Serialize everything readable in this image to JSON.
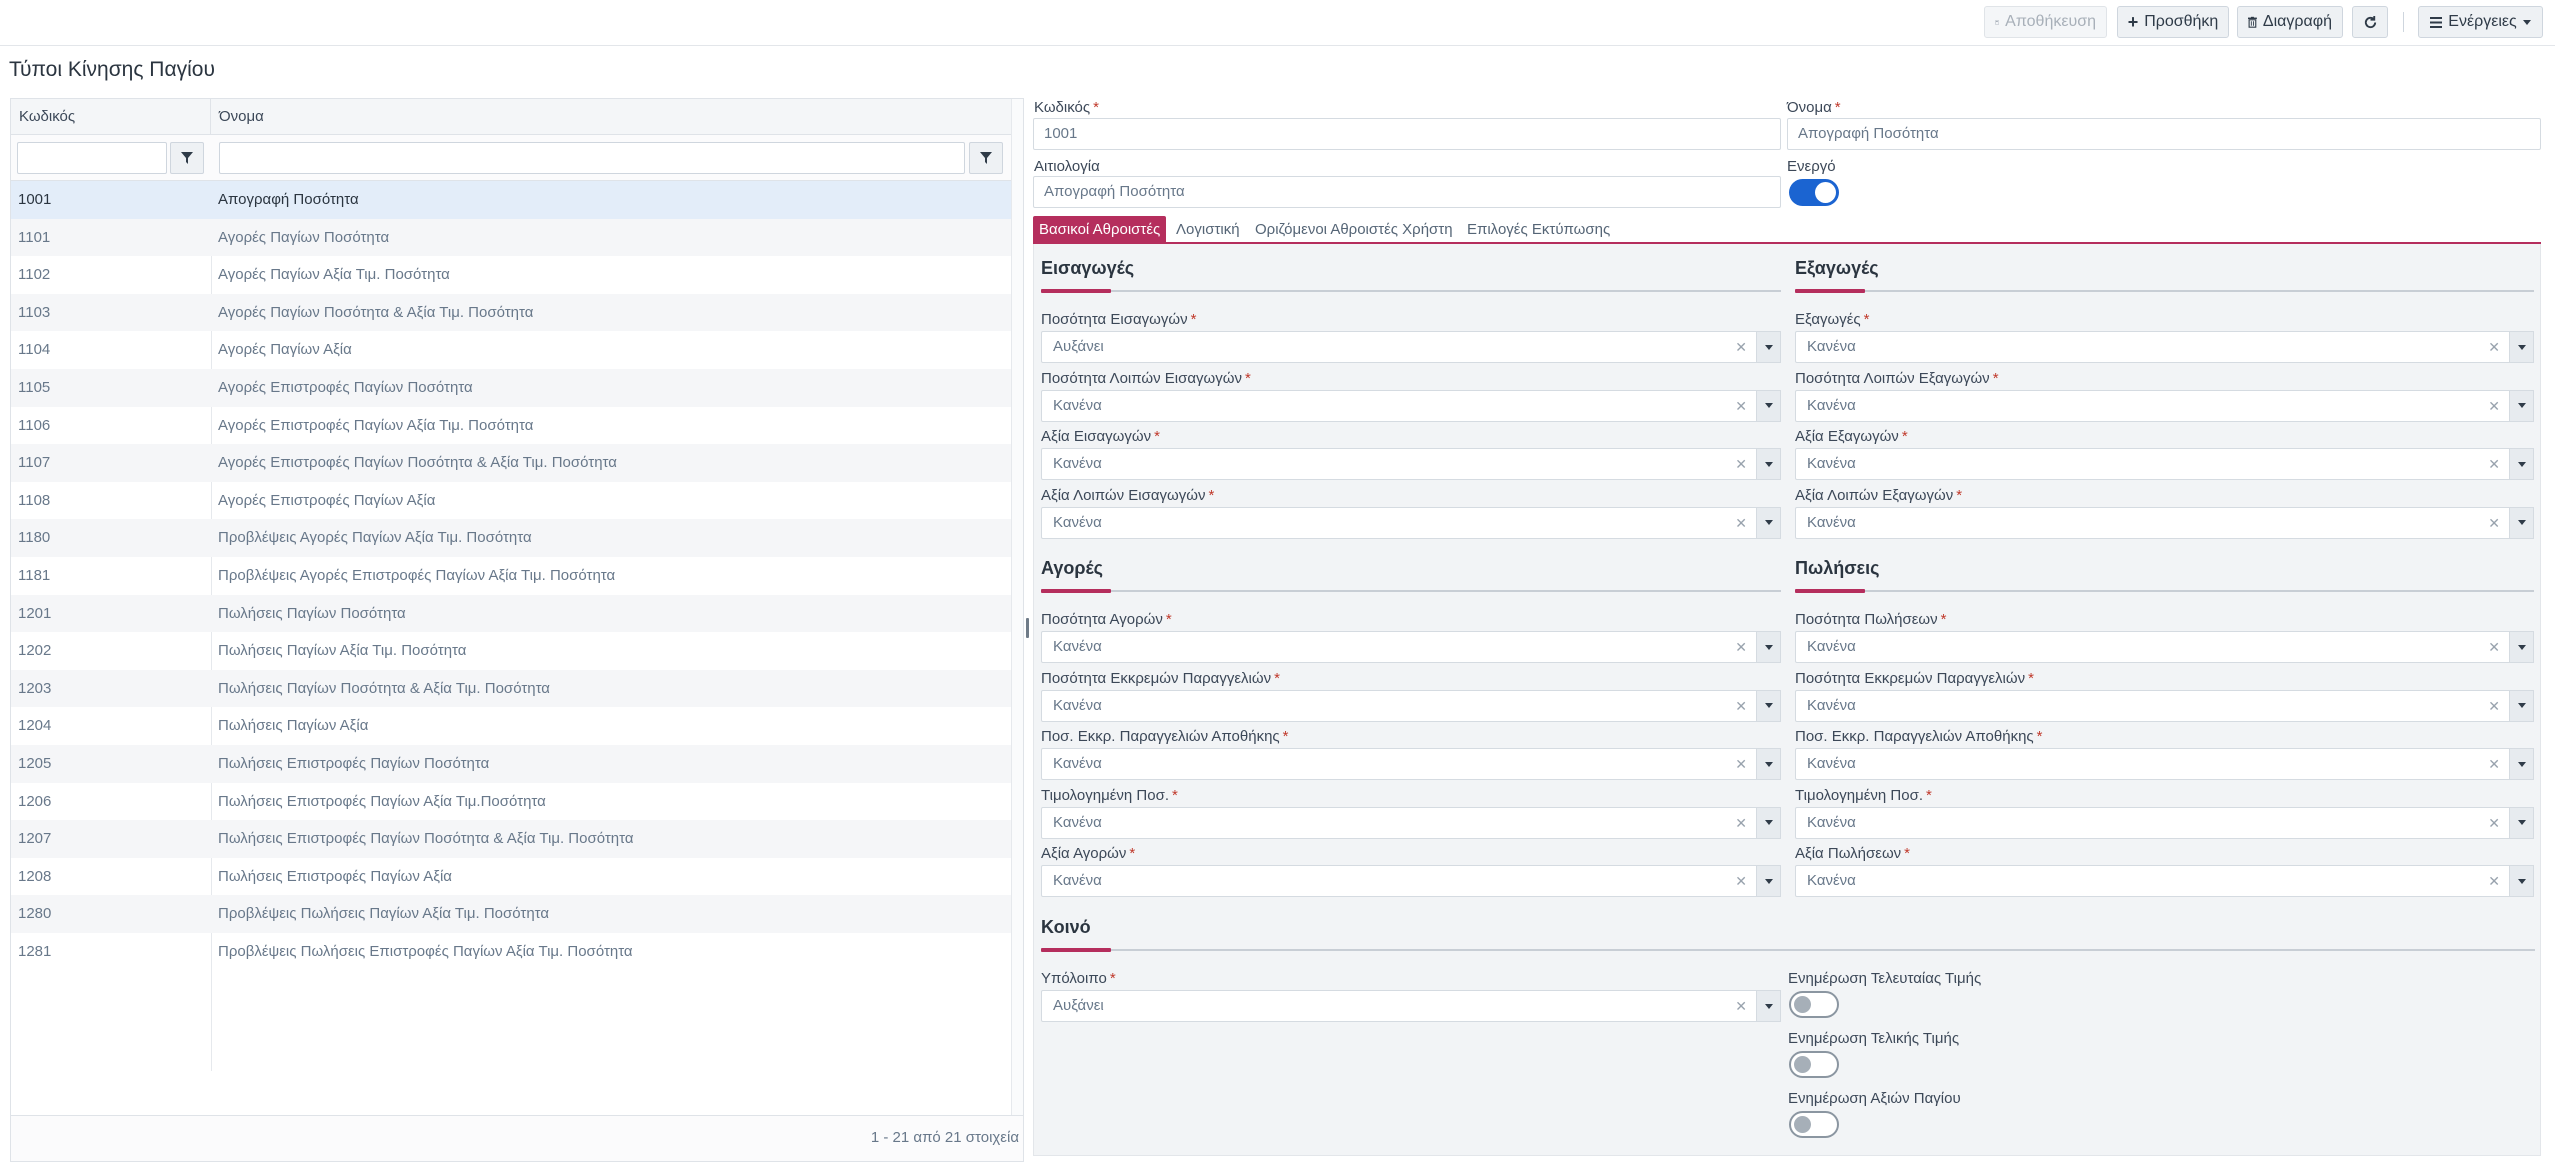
{
  "toolbar": {
    "save_label": "Αποθήκευση",
    "add_label": "Προσθήκη",
    "delete_label": "Διαγραφή",
    "actions_label": "Ενέργειες"
  },
  "page": {
    "title": "Τύποι Κίνησης Παγίου"
  },
  "grid": {
    "col_code": "Κωδικός",
    "col_name": "Όνομα",
    "rows": [
      {
        "code": "1001",
        "name": "Απογραφή Ποσότητα"
      },
      {
        "code": "1101",
        "name": "Αγορές Παγίων Ποσότητα"
      },
      {
        "code": "1102",
        "name": "Αγορές Παγίων Αξία Τιμ. Ποσότητα"
      },
      {
        "code": "1103",
        "name": "Αγορές Παγίων Ποσότητα & Αξία Τιμ. Ποσότητα"
      },
      {
        "code": "1104",
        "name": "Αγορές Παγίων Αξία"
      },
      {
        "code": "1105",
        "name": "Αγορές Επιστροφές Παγίων Ποσότητα"
      },
      {
        "code": "1106",
        "name": "Αγορές Επιστροφές Παγίων Αξία Τιμ. Ποσότητα"
      },
      {
        "code": "1107",
        "name": "Αγορές Επιστροφές Παγίων Ποσότητα & Αξία Τιμ. Ποσότητα"
      },
      {
        "code": "1108",
        "name": "Αγορές Επιστροφές Παγίων Αξία"
      },
      {
        "code": "1180",
        "name": "Προβλέψεις Αγορές Παγίων Αξία Τιμ. Ποσότητα"
      },
      {
        "code": "1181",
        "name": "Προβλέψεις Αγορές Επιστροφές Παγίων Αξία Τιμ. Ποσότητα"
      },
      {
        "code": "1201",
        "name": "Πωλήσεις Παγίων Ποσότητα"
      },
      {
        "code": "1202",
        "name": "Πωλήσεις Παγίων Αξία Τιμ. Ποσότητα"
      },
      {
        "code": "1203",
        "name": "Πωλήσεις Παγίων Ποσότητα & Αξία Τιμ. Ποσότητα"
      },
      {
        "code": "1204",
        "name": "Πωλήσεις Παγίων Αξία"
      },
      {
        "code": "1205",
        "name": "Πωλήσεις Επιστροφές Παγίων Ποσότητα"
      },
      {
        "code": "1206",
        "name": "Πωλήσεις Επιστροφές Παγίων Αξία Τιμ.Ποσότητα"
      },
      {
        "code": "1207",
        "name": "Πωλήσεις Επιστροφές Παγίων Ποσότητα & Αξία Τιμ. Ποσότητα"
      },
      {
        "code": "1208",
        "name": "Πωλήσεις Επιστροφές Παγίων Αξία"
      },
      {
        "code": "1280",
        "name": "Προβλέψεις Πωλήσεις Παγίων Αξία Τιμ. Ποσότητα"
      },
      {
        "code": "1281",
        "name": "Προβλέψεις Πωλήσεις Επιστροφές Παγίων Αξία Τιμ. Ποσότητα"
      }
    ],
    "footer": "1 - 21 από 21 στοιχεία"
  },
  "form": {
    "code_label": "Κωδικός",
    "code_value": "1001",
    "name_label": "Όνομα",
    "name_value": "Απογραφή Ποσότητα",
    "reason_label": "Αιτιολογία",
    "reason_value": "Απογραφή Ποσότητα",
    "active_label": "Ενεργό",
    "active": true
  },
  "tabs": [
    "Βασικοί Αθροιστές",
    "Λογιστική",
    "Οριζόμενοι Αθροιστές Χρήστη",
    "Επιλογές Εκτύπωσης"
  ],
  "sections": {
    "imports": {
      "title": "Εισαγωγές",
      "fields": [
        {
          "label": "Ποσότητα Εισαγωγών",
          "value": "Αυξάνει"
        },
        {
          "label": "Ποσότητα Λοιπών Εισαγωγών",
          "value": "Κανένα"
        },
        {
          "label": "Αξία Εισαγωγών",
          "value": "Κανένα"
        },
        {
          "label": "Αξία Λοιπών Εισαγωγών",
          "value": "Κανένα"
        }
      ]
    },
    "exports": {
      "title": "Εξαγωγές",
      "fields": [
        {
          "label": "Εξαγωγές",
          "value": "Κανένα"
        },
        {
          "label": "Ποσότητα Λοιπών Εξαγωγών",
          "value": "Κανένα"
        },
        {
          "label": "Αξία Εξαγωγών",
          "value": "Κανένα"
        },
        {
          "label": "Αξία Λοιπών Εξαγωγών",
          "value": "Κανένα"
        }
      ]
    },
    "purchases": {
      "title": "Αγορές",
      "fields": [
        {
          "label": "Ποσότητα Αγορών",
          "value": "Κανένα"
        },
        {
          "label": "Ποσότητα Εκκρεμών Παραγγελιών",
          "value": "Κανένα"
        },
        {
          "label": "Ποσ. Εκκρ. Παραγγελιών Αποθήκης",
          "value": "Κανένα"
        },
        {
          "label": "Τιμολογημένη Ποσ.",
          "value": "Κανένα"
        },
        {
          "label": "Αξία Αγορών",
          "value": "Κανένα"
        }
      ]
    },
    "sales": {
      "title": "Πωλήσεις",
      "fields": [
        {
          "label": "Ποσότητα Πωλήσεων",
          "value": "Κανένα"
        },
        {
          "label": "Ποσότητα Εκκρεμών Παραγγελιών",
          "value": "Κανένα"
        },
        {
          "label": "Ποσ. Εκκρ. Παραγγελιών Αποθήκης",
          "value": "Κανένα"
        },
        {
          "label": "Τιμολογημένη Ποσ.",
          "value": "Κανένα"
        },
        {
          "label": "Αξία Πωλήσεων",
          "value": "Κανένα"
        }
      ]
    },
    "common": {
      "title": "Κοινό",
      "balance_label": "Υπόλοιπο",
      "balance_value": "Αυξάνει",
      "toggles": [
        {
          "label": "Ενημέρωση Τελευταίας Τιμής",
          "value": false
        },
        {
          "label": "Ενημέρωση Τελικής Τιμής",
          "value": false
        },
        {
          "label": "Ενημέρωση Αξιών Παγίου",
          "value": false
        }
      ]
    }
  },
  "colors": {
    "accent": "#b52e5d",
    "toggle_on": "#1b64d1",
    "selected_row": "#e3edf9"
  }
}
